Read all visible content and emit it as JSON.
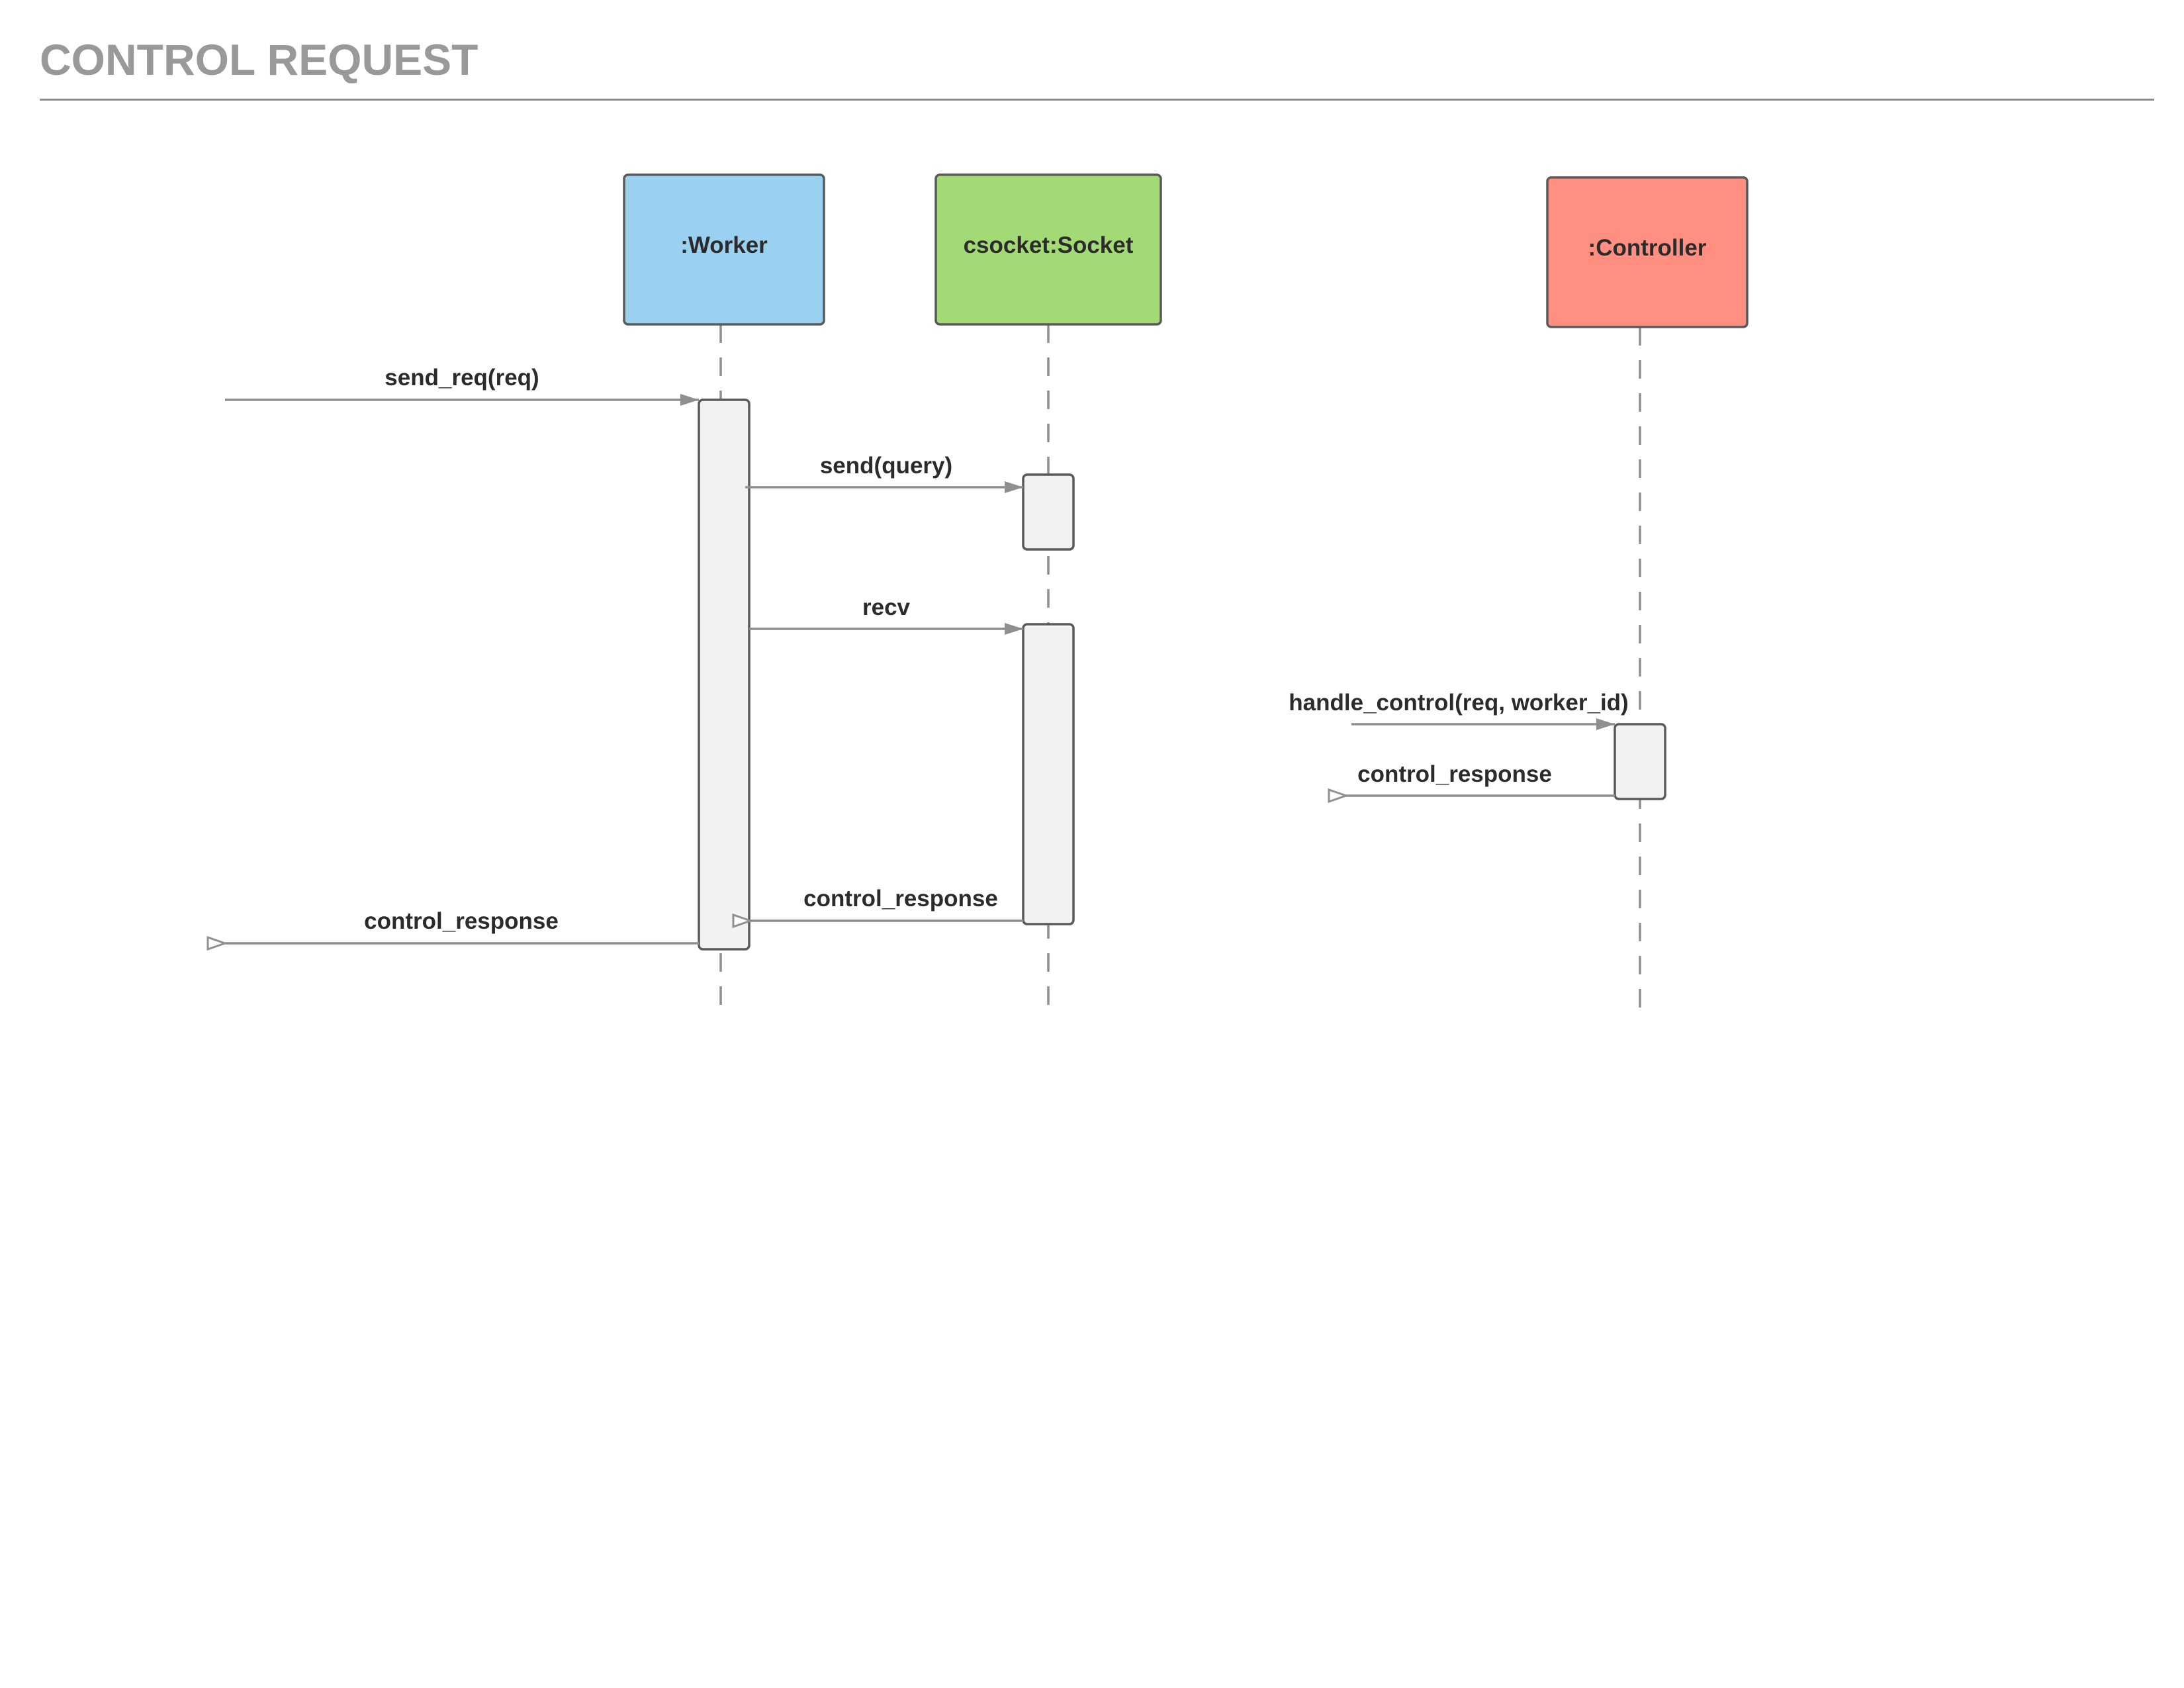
{
  "title": "CONTROL REQUEST",
  "colors": {
    "worker": "#9ad1f1",
    "socket": "#a4da76",
    "controller": "#ff8f80",
    "activation": "#f2f2f2",
    "line": "#8f8f8f",
    "border": "#5a5a5a"
  },
  "participants": {
    "worker": ":Worker",
    "socket": "csocket:Socket",
    "controller": ":Controller"
  },
  "messages": {
    "m1": "send_req(req)",
    "m2": "send(query)",
    "m3": "recv",
    "m4": "handle_control(req, worker_id)",
    "m5": "control_response",
    "m6": "control_response",
    "m7": "control_response"
  }
}
